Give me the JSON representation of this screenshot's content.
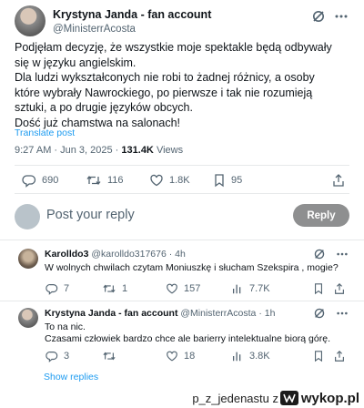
{
  "tweet": {
    "author_name": "Krystyna Janda - fan account",
    "author_handle": "@MinisterrAcosta",
    "lines": [
      "Podjęłam decyzję, że wszystkie moje spektakle będą odbywały się w języku angielskim.",
      "Dla ludzi wykształconych nie robi to żadnej różnicy, a osoby które wybrały Nawrockiego, po pierwsze i tak nie rozumieją sztuki, a po drugie języków obcych.",
      "Dość już chamstwa na salonach!"
    ],
    "translate_label": "Translate post",
    "time": "9:27 AM · Jun 3, 2025 · ",
    "views_count": "131.4K",
    "views_label": " Views",
    "stats": {
      "replies": "690",
      "reposts": "116",
      "likes": "1.8K",
      "bookmarks": "95"
    }
  },
  "compose": {
    "placeholder": "Post your reply",
    "button_label": "Reply"
  },
  "replies": [
    {
      "name": "Karolldo3",
      "handle": "@karolldo317676",
      "time": " · 4h",
      "lines": [
        "W wolnych chwilach czytam Moniuszkę i słucham Szekspira , mogie?"
      ],
      "stats": {
        "replies": "7",
        "reposts": "1",
        "likes": "157",
        "views": "7.7K"
      }
    },
    {
      "name": "Krystyna Janda - fan account",
      "handle": "@MinisterrAcosta",
      "time": " · 1h",
      "lines": [
        "To na nic.",
        "Czasami człowiek bardzo chce ale barierry intelektualne biorą górę."
      ],
      "stats": {
        "replies": "3",
        "reposts": "",
        "likes": "18",
        "views": "3.8K"
      }
    }
  ],
  "show_replies_label": "Show replies",
  "watermark": {
    "user": "p_z_jedenastu  z",
    "site": "wykop.pl"
  },
  "colors": {
    "text": "#0f1419",
    "muted": "#536471",
    "link": "#1d9bf0",
    "divider": "#e7e9ea",
    "reply_button": "#8e8f90"
  },
  "icons": [
    "grok-icon",
    "more-icon",
    "reply-icon",
    "repost-icon",
    "like-icon",
    "views-icon",
    "bookmark-icon",
    "share-icon"
  ]
}
